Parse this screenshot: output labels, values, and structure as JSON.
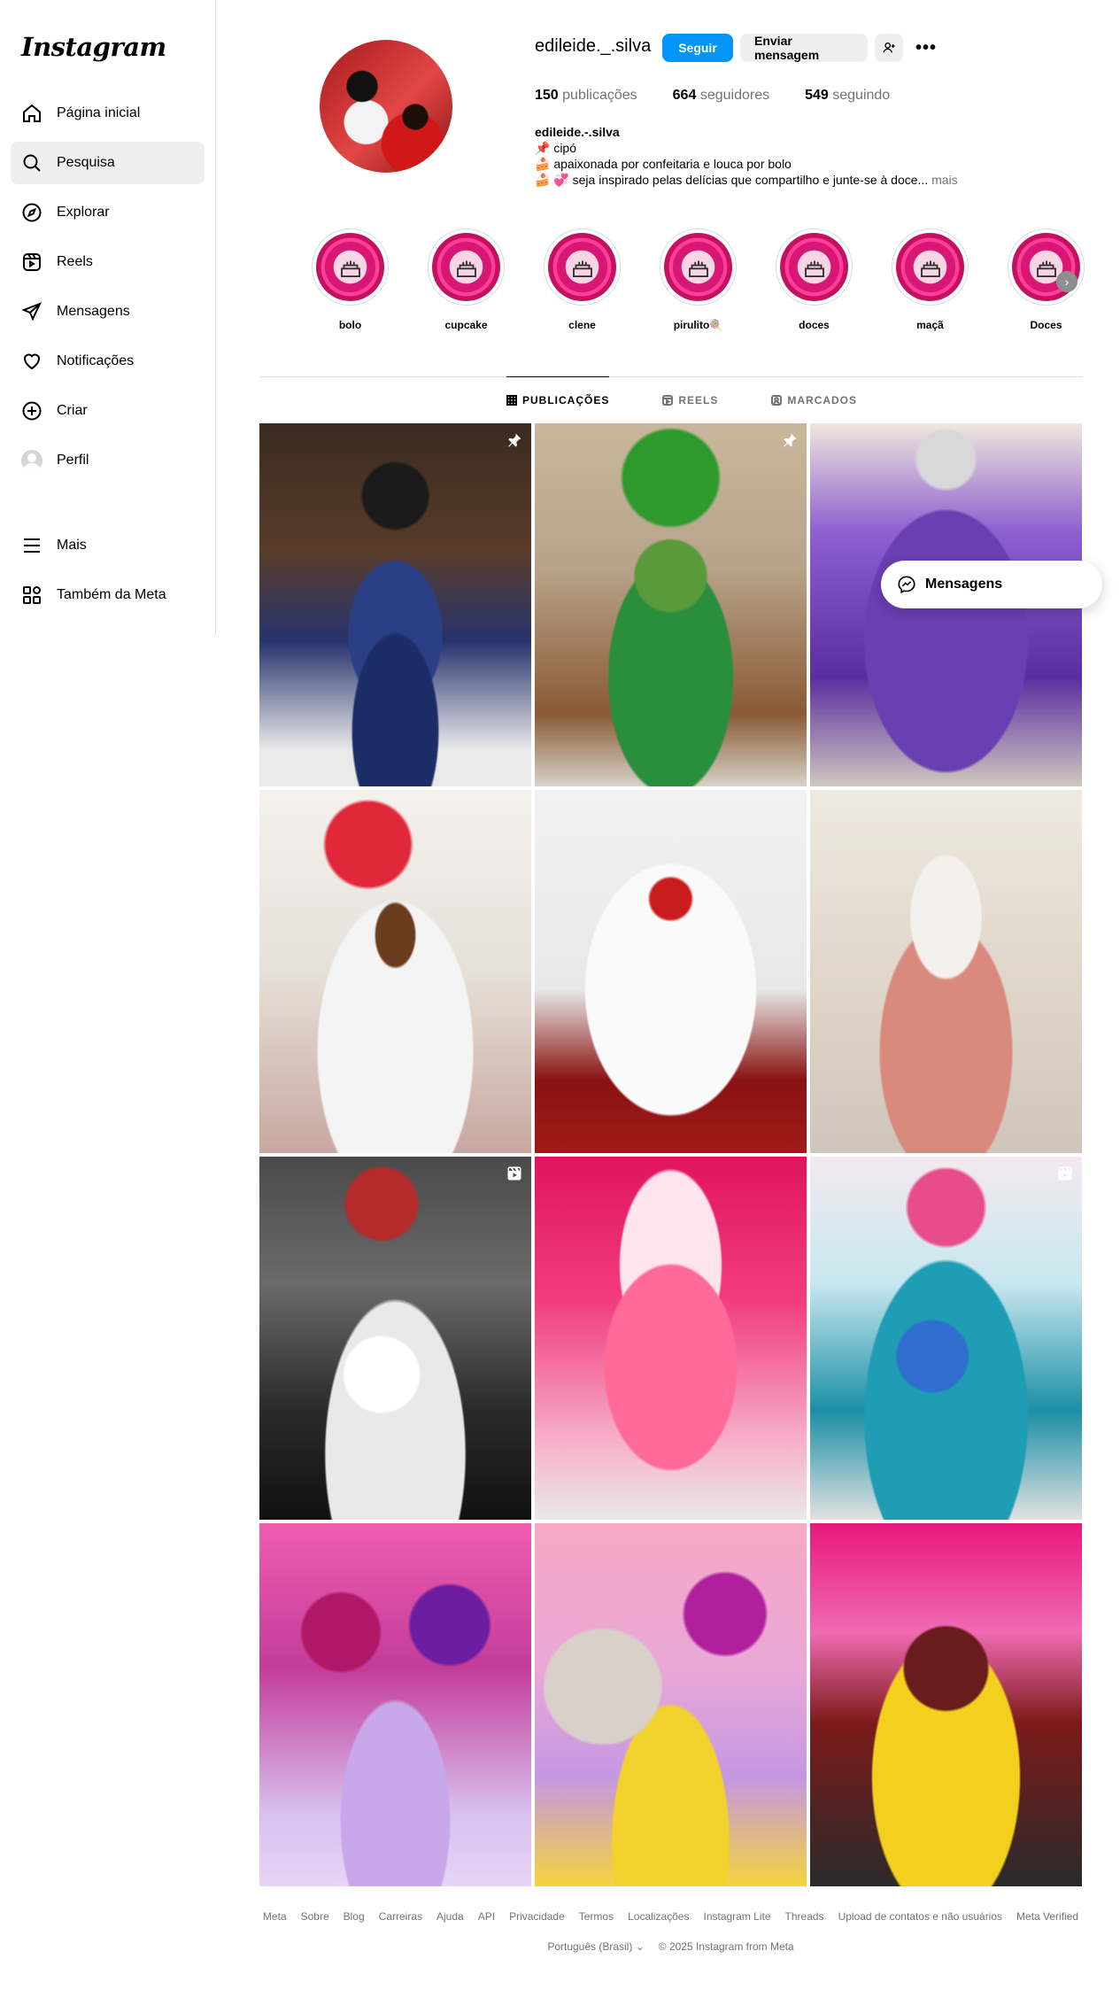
{
  "app": {
    "logo": "Instagram"
  },
  "sidebar": {
    "items": [
      {
        "label": "Página inicial",
        "icon": "home-icon"
      },
      {
        "label": "Pesquisa",
        "icon": "search-icon",
        "active": true
      },
      {
        "label": "Explorar",
        "icon": "compass-icon"
      },
      {
        "label": "Reels",
        "icon": "reels-icon"
      },
      {
        "label": "Mensagens",
        "icon": "paper-plane-icon"
      },
      {
        "label": "Notificações",
        "icon": "heart-icon"
      },
      {
        "label": "Criar",
        "icon": "plus-square-icon"
      },
      {
        "label": "Perfil",
        "icon": "avatar"
      }
    ],
    "bottom": [
      {
        "label": "Mais",
        "icon": "menu-icon"
      },
      {
        "label": "Também da Meta",
        "icon": "meta-apps-icon"
      }
    ]
  },
  "profile": {
    "username": "edileide._.silva",
    "follow_label": "Seguir",
    "message_label": "Enviar mensagem",
    "stats": {
      "posts_count": "150",
      "posts_label": "publicações",
      "followers_count": "664",
      "followers_label": "seguidores",
      "following_count": "549",
      "following_label": "seguindo"
    },
    "bio": {
      "name": "edileide.-.silva",
      "line1": "📌 cipó",
      "line2": "🍰 apaixonada por confeitaria e louca por bolo",
      "line3": "🍰 💞 seja inspirado pelas delícias que compartilho e junte-se à doce...",
      "more": "mais"
    }
  },
  "highlights": [
    {
      "label": "bolo"
    },
    {
      "label": "cupcake"
    },
    {
      "label": "clene"
    },
    {
      "label": "pirulito🍭"
    },
    {
      "label": "doces"
    },
    {
      "label": "maçã"
    },
    {
      "label": "Doces"
    }
  ],
  "tabs": [
    {
      "label": "PUBLICAÇÕES",
      "icon": "grid-icon",
      "active": true
    },
    {
      "label": "REELS",
      "icon": "reels-icon"
    },
    {
      "label": "MARCADOS",
      "icon": "tagged-icon"
    }
  ],
  "posts": [
    {
      "badge": "pin-icon"
    },
    {
      "badge": "pin-icon"
    },
    {
      "badge": ""
    },
    {
      "badge": ""
    },
    {
      "badge": ""
    },
    {
      "badge": ""
    },
    {
      "badge": "reel-icon"
    },
    {
      "badge": ""
    },
    {
      "badge": "reel-icon"
    },
    {
      "badge": ""
    },
    {
      "badge": ""
    },
    {
      "badge": ""
    }
  ],
  "floating": {
    "messages_label": "Mensagens"
  },
  "footer": {
    "links": [
      "Meta",
      "Sobre",
      "Blog",
      "Carreiras",
      "Ajuda",
      "API",
      "Privacidade",
      "Termos",
      "Localizações",
      "Instagram Lite",
      "Threads",
      "Upload de contatos e não usuários",
      "Meta Verified"
    ],
    "language": "Português (Brasil)",
    "copyright": "© 2025 Instagram from Meta"
  },
  "colors": {
    "accent": "#0095f6",
    "border": "#dbdbdb",
    "muted": "#737373"
  }
}
